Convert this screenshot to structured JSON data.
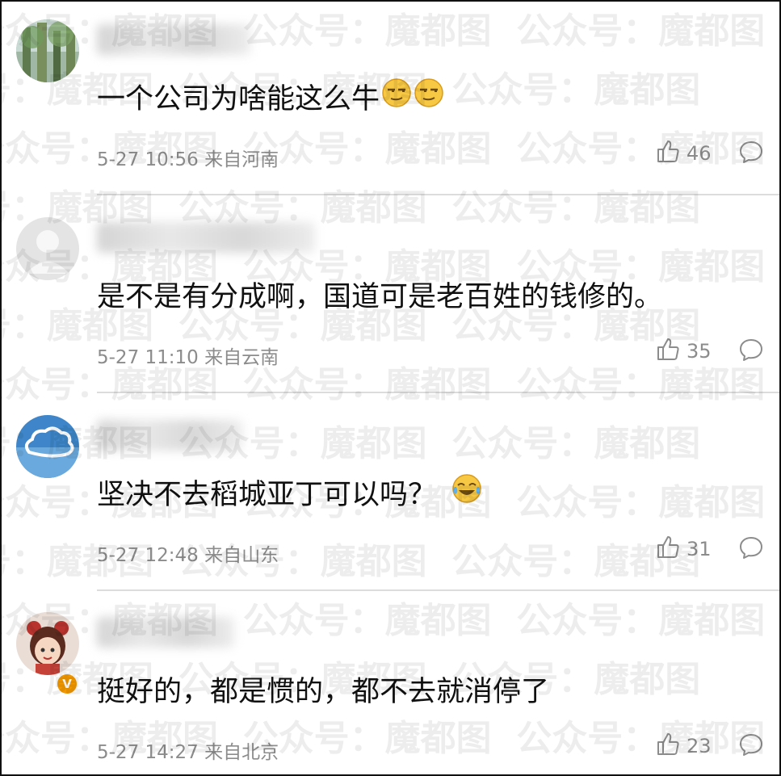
{
  "watermark": {
    "text": "公众号：魔都图"
  },
  "comments": [
    {
      "text": "一个公司为啥能这么牛",
      "emojis": [
        "smirk-emoji",
        "smirk-emoji"
      ],
      "time": "5-27 10:56",
      "location": "来自河南",
      "likes": "46"
    },
    {
      "text": "是不是有分成啊，国道可是老百姓的钱修的。",
      "emojis": [],
      "time": "5-27 11:10",
      "location": "来自云南",
      "likes": "35"
    },
    {
      "text": "坚决不去稻城亚丁可以吗？",
      "emojis": [
        "laugh-cry-emoji"
      ],
      "time": "5-27 12:48",
      "location": "来自山东",
      "likes": "31"
    },
    {
      "text": "挺好的，都是惯的，都不去就消停了",
      "emojis": [],
      "time": "5-27 14:27",
      "location": "来自北京",
      "likes": "23",
      "verified_badge": "V"
    }
  ],
  "colors": {
    "meta_gray": "#8c8c8c",
    "divider": "#dcdcdc",
    "badge_orange": "#f39800"
  }
}
